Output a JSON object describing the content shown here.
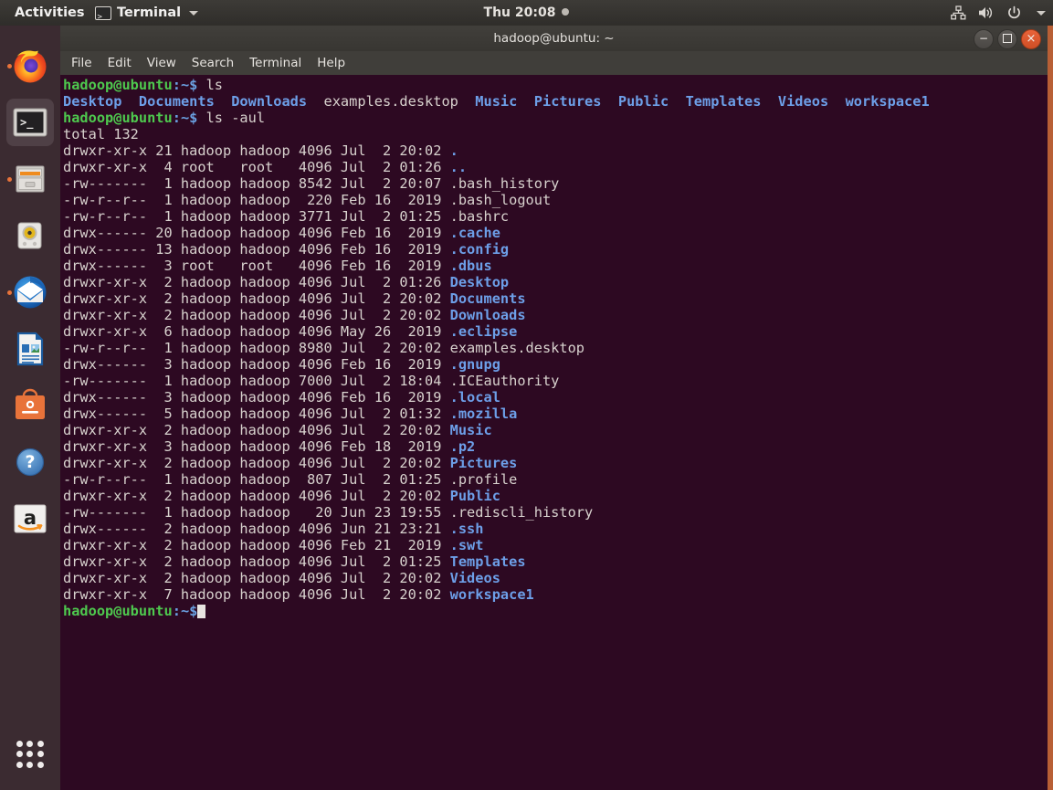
{
  "top_panel": {
    "activities": "Activities",
    "app_name": "Terminal",
    "clock": "Thu 20:08",
    "tray_icons": [
      "network-icon",
      "volume-icon",
      "power-icon",
      "chevron-down-icon"
    ]
  },
  "dock": {
    "items": [
      {
        "name": "firefox",
        "label": "Firefox",
        "running": true,
        "active": false
      },
      {
        "name": "terminal",
        "label": "Terminal",
        "running": true,
        "active": true
      },
      {
        "name": "files",
        "label": "Files",
        "running": true,
        "active": false
      },
      {
        "name": "rhythmbox",
        "label": "Rhythmbox",
        "running": false,
        "active": false
      },
      {
        "name": "thunderbird",
        "label": "Thunderbird",
        "running": false,
        "active": false
      },
      {
        "name": "libreoffice-writer",
        "label": "LibreOffice Writer",
        "running": false,
        "active": false
      },
      {
        "name": "ubuntu-software",
        "label": "Ubuntu Software",
        "running": false,
        "active": false
      },
      {
        "name": "help",
        "label": "Help",
        "running": false,
        "active": false
      },
      {
        "name": "amazon",
        "label": "Amazon",
        "running": false,
        "active": false
      }
    ],
    "show_apps_label": "Show Applications"
  },
  "window": {
    "title": "hadoop@ubuntu: ~",
    "menu": [
      "File",
      "Edit",
      "View",
      "Search",
      "Terminal",
      "Help"
    ],
    "buttons": {
      "minimize": "minimize",
      "maximize": "maximize",
      "close": "close"
    }
  },
  "terminal": {
    "prompt": "hadoop@ubuntu",
    "prompt_path": ":~$",
    "lines": [
      {
        "type": "prompt",
        "command": " ls"
      },
      {
        "type": "listing",
        "items": [
          "Desktop",
          "Documents",
          "Downloads",
          "examples.desktop",
          "Music",
          "Pictures",
          "Public",
          "Templates",
          "Videos",
          "workspace1"
        ]
      },
      {
        "type": "prompt",
        "command": " ls -aul"
      },
      {
        "type": "plain",
        "text": "total 132"
      },
      {
        "type": "row",
        "perms": "drwxr-xr-x",
        "links": "21",
        "user": "hadoop",
        "group": "hadoop",
        "size": "4096",
        "month": "Jul",
        "day": " 2",
        "time": "20:02",
        "name": ".",
        "dir": true
      },
      {
        "type": "row",
        "perms": "drwxr-xr-x",
        "links": " 4",
        "user": "root  ",
        "group": "root  ",
        "size": "4096",
        "month": "Jul",
        "day": " 2",
        "time": "01:26",
        "name": "..",
        "dir": true
      },
      {
        "type": "row",
        "perms": "-rw-------",
        "links": " 1",
        "user": "hadoop",
        "group": "hadoop",
        "size": "8542",
        "month": "Jul",
        "day": " 2",
        "time": "20:07",
        "name": ".bash_history",
        "dir": false
      },
      {
        "type": "row",
        "perms": "-rw-r--r--",
        "links": " 1",
        "user": "hadoop",
        "group": "hadoop",
        "size": " 220",
        "month": "Feb",
        "day": "16",
        "time": " 2019",
        "name": ".bash_logout",
        "dir": false
      },
      {
        "type": "row",
        "perms": "-rw-r--r--",
        "links": " 1",
        "user": "hadoop",
        "group": "hadoop",
        "size": "3771",
        "month": "Jul",
        "day": " 2",
        "time": "01:25",
        "name": ".bashrc",
        "dir": false
      },
      {
        "type": "row",
        "perms": "drwx------",
        "links": "20",
        "user": "hadoop",
        "group": "hadoop",
        "size": "4096",
        "month": "Feb",
        "day": "16",
        "time": " 2019",
        "name": ".cache",
        "dir": true
      },
      {
        "type": "row",
        "perms": "drwx------",
        "links": "13",
        "user": "hadoop",
        "group": "hadoop",
        "size": "4096",
        "month": "Feb",
        "day": "16",
        "time": " 2019",
        "name": ".config",
        "dir": true
      },
      {
        "type": "row",
        "perms": "drwx------",
        "links": " 3",
        "user": "root  ",
        "group": "root  ",
        "size": "4096",
        "month": "Feb",
        "day": "16",
        "time": " 2019",
        "name": ".dbus",
        "dir": true
      },
      {
        "type": "row",
        "perms": "drwxr-xr-x",
        "links": " 2",
        "user": "hadoop",
        "group": "hadoop",
        "size": "4096",
        "month": "Jul",
        "day": " 2",
        "time": "01:26",
        "name": "Desktop",
        "dir": true
      },
      {
        "type": "row",
        "perms": "drwxr-xr-x",
        "links": " 2",
        "user": "hadoop",
        "group": "hadoop",
        "size": "4096",
        "month": "Jul",
        "day": " 2",
        "time": "20:02",
        "name": "Documents",
        "dir": true
      },
      {
        "type": "row",
        "perms": "drwxr-xr-x",
        "links": " 2",
        "user": "hadoop",
        "group": "hadoop",
        "size": "4096",
        "month": "Jul",
        "day": " 2",
        "time": "20:02",
        "name": "Downloads",
        "dir": true
      },
      {
        "type": "row",
        "perms": "drwxr-xr-x",
        "links": " 6",
        "user": "hadoop",
        "group": "hadoop",
        "size": "4096",
        "month": "May",
        "day": "26",
        "time": " 2019",
        "name": ".eclipse",
        "dir": true
      },
      {
        "type": "row",
        "perms": "-rw-r--r--",
        "links": " 1",
        "user": "hadoop",
        "group": "hadoop",
        "size": "8980",
        "month": "Jul",
        "day": " 2",
        "time": "20:02",
        "name": "examples.desktop",
        "dir": false
      },
      {
        "type": "row",
        "perms": "drwx------",
        "links": " 3",
        "user": "hadoop",
        "group": "hadoop",
        "size": "4096",
        "month": "Feb",
        "day": "16",
        "time": " 2019",
        "name": ".gnupg",
        "dir": true
      },
      {
        "type": "row",
        "perms": "-rw-------",
        "links": " 1",
        "user": "hadoop",
        "group": "hadoop",
        "size": "7000",
        "month": "Jul",
        "day": " 2",
        "time": "18:04",
        "name": ".ICEauthority",
        "dir": false
      },
      {
        "type": "row",
        "perms": "drwx------",
        "links": " 3",
        "user": "hadoop",
        "group": "hadoop",
        "size": "4096",
        "month": "Feb",
        "day": "16",
        "time": " 2019",
        "name": ".local",
        "dir": true
      },
      {
        "type": "row",
        "perms": "drwx------",
        "links": " 5",
        "user": "hadoop",
        "group": "hadoop",
        "size": "4096",
        "month": "Jul",
        "day": " 2",
        "time": "01:32",
        "name": ".mozilla",
        "dir": true
      },
      {
        "type": "row",
        "perms": "drwxr-xr-x",
        "links": " 2",
        "user": "hadoop",
        "group": "hadoop",
        "size": "4096",
        "month": "Jul",
        "day": " 2",
        "time": "20:02",
        "name": "Music",
        "dir": true
      },
      {
        "type": "row",
        "perms": "drwxr-xr-x",
        "links": " 3",
        "user": "hadoop",
        "group": "hadoop",
        "size": "4096",
        "month": "Feb",
        "day": "18",
        "time": " 2019",
        "name": ".p2",
        "dir": true
      },
      {
        "type": "row",
        "perms": "drwxr-xr-x",
        "links": " 2",
        "user": "hadoop",
        "group": "hadoop",
        "size": "4096",
        "month": "Jul",
        "day": " 2",
        "time": "20:02",
        "name": "Pictures",
        "dir": true
      },
      {
        "type": "row",
        "perms": "-rw-r--r--",
        "links": " 1",
        "user": "hadoop",
        "group": "hadoop",
        "size": " 807",
        "month": "Jul",
        "day": " 2",
        "time": "01:25",
        "name": ".profile",
        "dir": false
      },
      {
        "type": "row",
        "perms": "drwxr-xr-x",
        "links": " 2",
        "user": "hadoop",
        "group": "hadoop",
        "size": "4096",
        "month": "Jul",
        "day": " 2",
        "time": "20:02",
        "name": "Public",
        "dir": true
      },
      {
        "type": "row",
        "perms": "-rw-------",
        "links": " 1",
        "user": "hadoop",
        "group": "hadoop",
        "size": "  20",
        "month": "Jun",
        "day": "23",
        "time": "19:55",
        "name": ".rediscli_history",
        "dir": false
      },
      {
        "type": "row",
        "perms": "drwx------",
        "links": " 2",
        "user": "hadoop",
        "group": "hadoop",
        "size": "4096",
        "month": "Jun",
        "day": "21",
        "time": "23:21",
        "name": ".ssh",
        "dir": true
      },
      {
        "type": "row",
        "perms": "drwxr-xr-x",
        "links": " 2",
        "user": "hadoop",
        "group": "hadoop",
        "size": "4096",
        "month": "Feb",
        "day": "21",
        "time": " 2019",
        "name": ".swt",
        "dir": true
      },
      {
        "type": "row",
        "perms": "drwxr-xr-x",
        "links": " 2",
        "user": "hadoop",
        "group": "hadoop",
        "size": "4096",
        "month": "Jul",
        "day": " 2",
        "time": "01:25",
        "name": "Templates",
        "dir": true
      },
      {
        "type": "row",
        "perms": "drwxr-xr-x",
        "links": " 2",
        "user": "hadoop",
        "group": "hadoop",
        "size": "4096",
        "month": "Jul",
        "day": " 2",
        "time": "20:02",
        "name": "Videos",
        "dir": true
      },
      {
        "type": "row",
        "perms": "drwxr-xr-x",
        "links": " 7",
        "user": "hadoop",
        "group": "hadoop",
        "size": "4096",
        "month": "Jul",
        "day": " 2",
        "time": "20:02",
        "name": "workspace1",
        "dir": true
      },
      {
        "type": "prompt",
        "command": "",
        "cursor": true
      }
    ]
  },
  "colors": {
    "terminal_bg": "#2d0922",
    "prompt_green": "#4ec94e",
    "dir_blue": "#6d9fe8",
    "panel_bg": "#3d3b37",
    "dock_bg": "#3b2b31",
    "desktop_orange": "#b85f35",
    "close_button": "#e8633a"
  }
}
